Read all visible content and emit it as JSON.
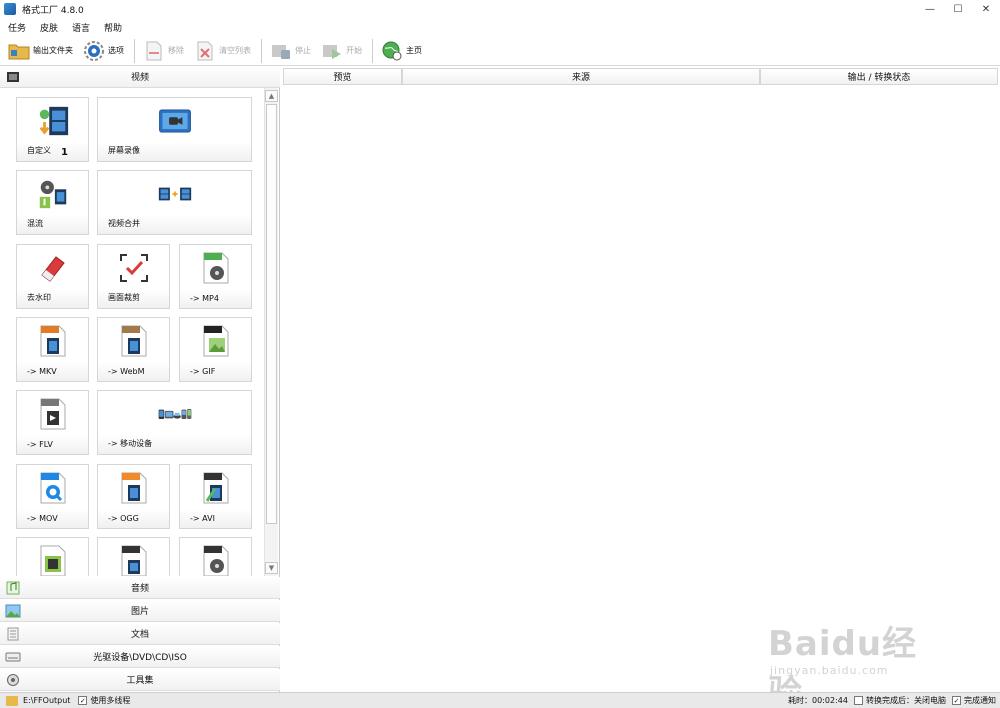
{
  "window": {
    "title": "格式工厂 4.8.0",
    "minimize": "—",
    "maximize": "☐",
    "close": "✕"
  },
  "menu": [
    "任务",
    "皮肤",
    "语言",
    "帮助"
  ],
  "toolbar": {
    "output_folder": "输出文件夹",
    "options": "选项",
    "remove": "移除",
    "clear_list": "清空列表",
    "stop": "停止",
    "start": "开始",
    "home": "主页"
  },
  "categories": {
    "video": "视频",
    "audio": "音频",
    "image": "图片",
    "document": "文档",
    "disc": "光驱设备\\DVD\\CD\\ISO",
    "tools": "工具集"
  },
  "tiles": {
    "custom": "自定义",
    "custom_badge": "1",
    "screen_record": "屏幕录像",
    "mix": "混流",
    "merge": "视频合并",
    "watermark": "去水印",
    "crop": "画面裁剪",
    "mp4": "-> MP4",
    "mkv": "-> MKV",
    "webm": "-> WebM",
    "gif": "-> GIF",
    "flv": "-> FLV",
    "mobile": "-> 移动设备",
    "mov": "-> MOV",
    "ogg": "-> OGG",
    "avi": "-> AVI"
  },
  "columns": {
    "preview": "预览",
    "source": "来源",
    "output_status": "输出 / 转换状态"
  },
  "status": {
    "output_path": "E:\\FFOutput",
    "multithread": "使用多线程",
    "elapsed": "耗时：00:02:44",
    "after_convert": "转换完成后：关闭电脑",
    "notify": "完成通知"
  },
  "watermark": {
    "main": "Baidu经验",
    "sub": "jingyan.baidu.com"
  }
}
